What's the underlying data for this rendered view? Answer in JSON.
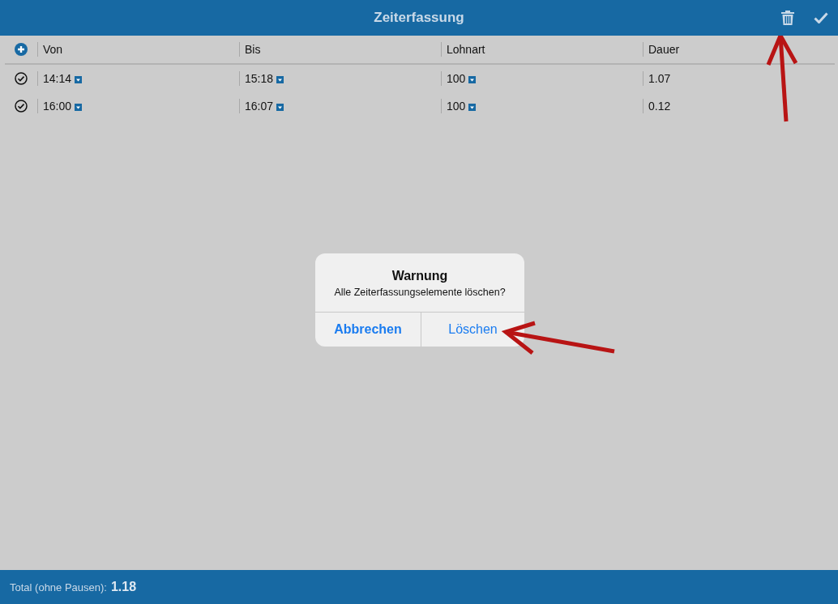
{
  "header": {
    "title": "Zeiterfassung"
  },
  "table": {
    "columns": [
      "Von",
      "Bis",
      "Lohnart",
      "Dauer"
    ],
    "rows": [
      {
        "checked": true,
        "von": "14:14",
        "bis": "15:18",
        "lohnart": "100",
        "dauer": "1.07"
      },
      {
        "checked": true,
        "von": "16:00",
        "bis": "16:07",
        "lohnart": "100",
        "dauer": "0.12"
      }
    ]
  },
  "dialog": {
    "title": "Warnung",
    "message": "Alle Zeiterfassungselemente löschen?",
    "buttons": [
      {
        "label": "Abbrechen",
        "kind": "cancel"
      },
      {
        "label": "Löschen",
        "kind": "destructive"
      }
    ]
  },
  "footer": {
    "label": "Total (ohne Pausen):",
    "value": "1.18"
  }
}
